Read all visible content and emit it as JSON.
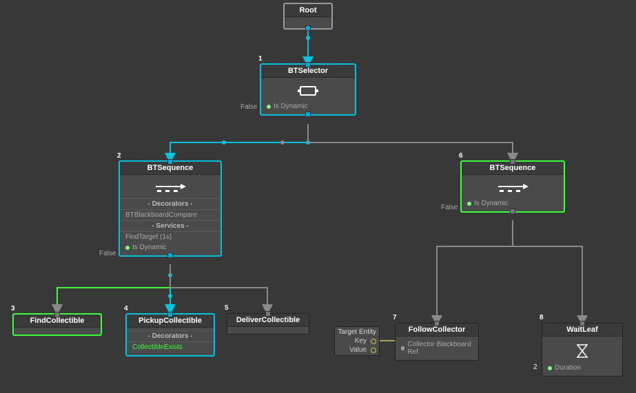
{
  "labels": {
    "false": "False",
    "decorators": "- Decorators -",
    "services": "- Services -"
  },
  "nodes": {
    "root": {
      "title": "Root"
    },
    "selector": {
      "index": "1",
      "title": "BTSelector",
      "prop": "Is Dynamic"
    },
    "seq2": {
      "index": "2",
      "title": "BTSequence",
      "decorator": "BTBlackboardCompare",
      "service": "FindTarget (1s)",
      "prop": "Is Dynamic"
    },
    "seq6": {
      "index": "6",
      "title": "BTSequence",
      "prop": "Is Dynamic"
    },
    "find": {
      "index": "3",
      "title": "FindCollectible"
    },
    "pickup": {
      "index": "4",
      "title": "PickupCollectible",
      "decorator": "CollectibleExists"
    },
    "deliver": {
      "index": "5",
      "title": "DeliverCollectible"
    },
    "follow": {
      "index": "7",
      "title": "FollowCollector",
      "prop": "Collector Blackboard Ref"
    },
    "wait": {
      "index": "8",
      "title": "WaitLeaf",
      "prop": "Duration",
      "count": "2"
    }
  },
  "panel": {
    "title": "Target Entity",
    "key": "Key",
    "value": "Value"
  }
}
